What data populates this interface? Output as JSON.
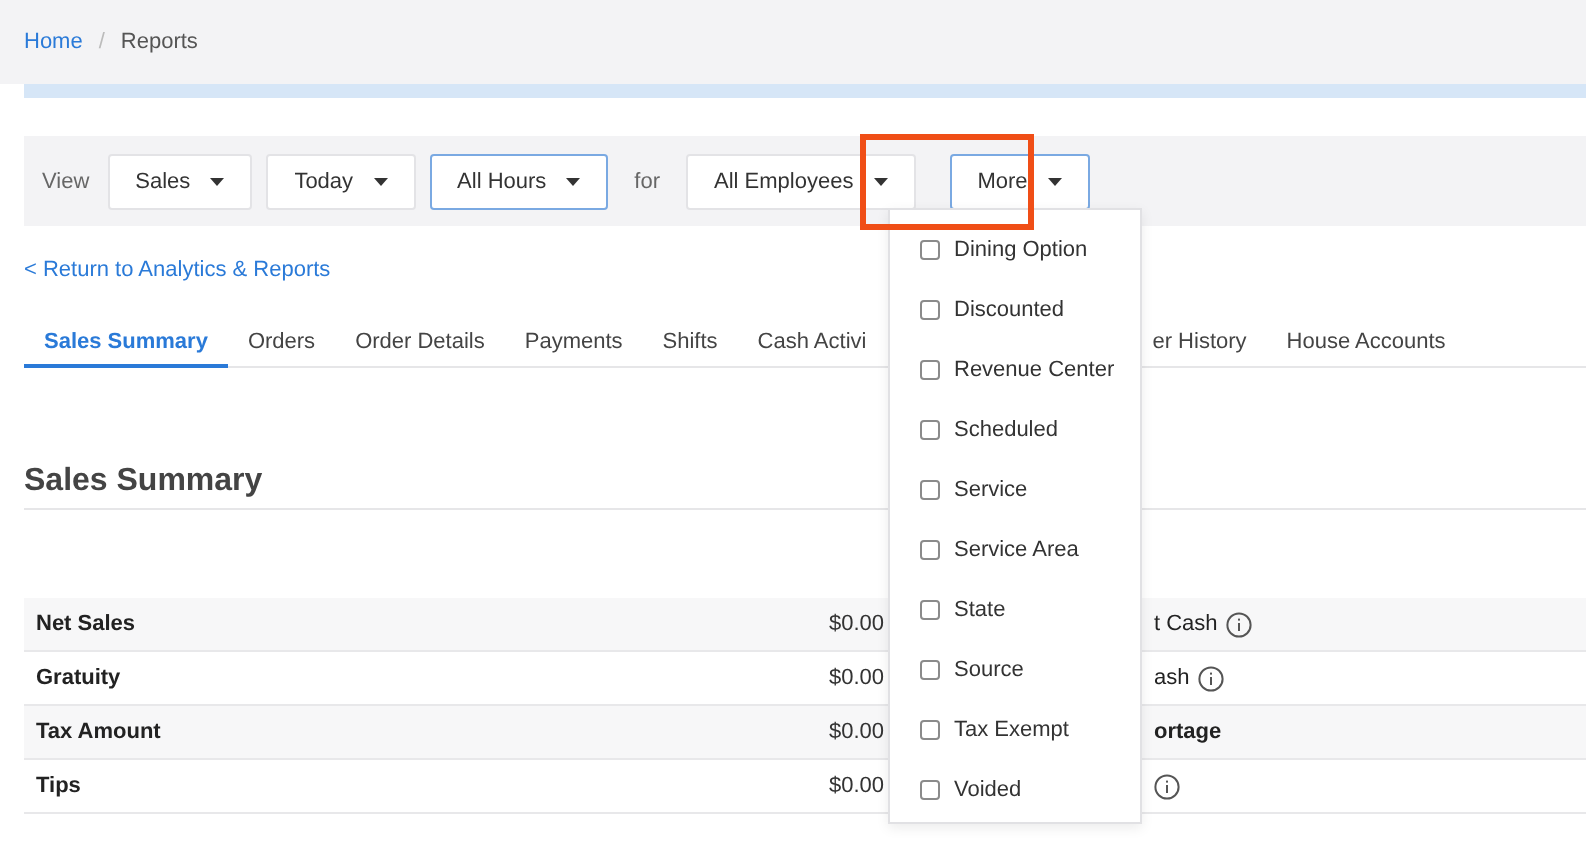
{
  "breadcrumb": {
    "home": "Home",
    "separator": "/",
    "current": "Reports"
  },
  "filter_bar": {
    "view_label": "View",
    "for_label": "for",
    "view_dropdowns": [
      {
        "label": "Sales",
        "focused": false
      },
      {
        "label": "Today",
        "focused": false
      },
      {
        "label": "All Hours",
        "focused": true
      }
    ],
    "for_dropdowns": [
      {
        "label": "All Employees",
        "focused": false
      },
      {
        "label": "More",
        "focused": true,
        "highlighted": true
      }
    ]
  },
  "back_link": "< Return to Analytics & Reports",
  "tabs": [
    {
      "label": "Sales Summary",
      "selected": true,
      "after_menu": false
    },
    {
      "label": "Orders",
      "selected": false,
      "after_menu": false
    },
    {
      "label": "Order Details",
      "selected": false,
      "after_menu": false
    },
    {
      "label": "Payments",
      "selected": false,
      "after_menu": false
    },
    {
      "label": "Shifts",
      "selected": false,
      "after_menu": false
    },
    {
      "label": "Cash Activi",
      "selected": false,
      "after_menu": false
    },
    {
      "label": "er History",
      "selected": false,
      "after_menu": true
    },
    {
      "label": "House Accounts",
      "selected": false,
      "after_menu": false
    }
  ],
  "section_title": "Sales Summary",
  "table": {
    "rows": [
      {
        "label": "Net Sales",
        "value": "$0.00",
        "column_3": "t Cash",
        "info": true,
        "bold3": false
      },
      {
        "label": "Gratuity",
        "value": "$0.00",
        "column_3": "ash",
        "info": true,
        "bold3": false
      },
      {
        "label": "Tax Amount",
        "value": "$0.00",
        "column_3": "ortage",
        "info": false,
        "bold3": true
      },
      {
        "label": "Tips",
        "value": "$0.00",
        "info": true
      }
    ]
  },
  "more_menu": {
    "items": [
      {
        "label": "Dining Option",
        "checked": false
      },
      {
        "label": "Discounted",
        "checked": false
      },
      {
        "label": "Revenue Center",
        "checked": false
      },
      {
        "label": "Scheduled",
        "checked": false
      },
      {
        "label": "Service",
        "checked": false
      },
      {
        "label": "Service Area",
        "checked": false
      },
      {
        "label": "State",
        "checked": false
      },
      {
        "label": "Source",
        "checked": false
      },
      {
        "label": "Tax Exempt",
        "checked": false
      },
      {
        "label": "Voided",
        "checked": false
      }
    ]
  }
}
